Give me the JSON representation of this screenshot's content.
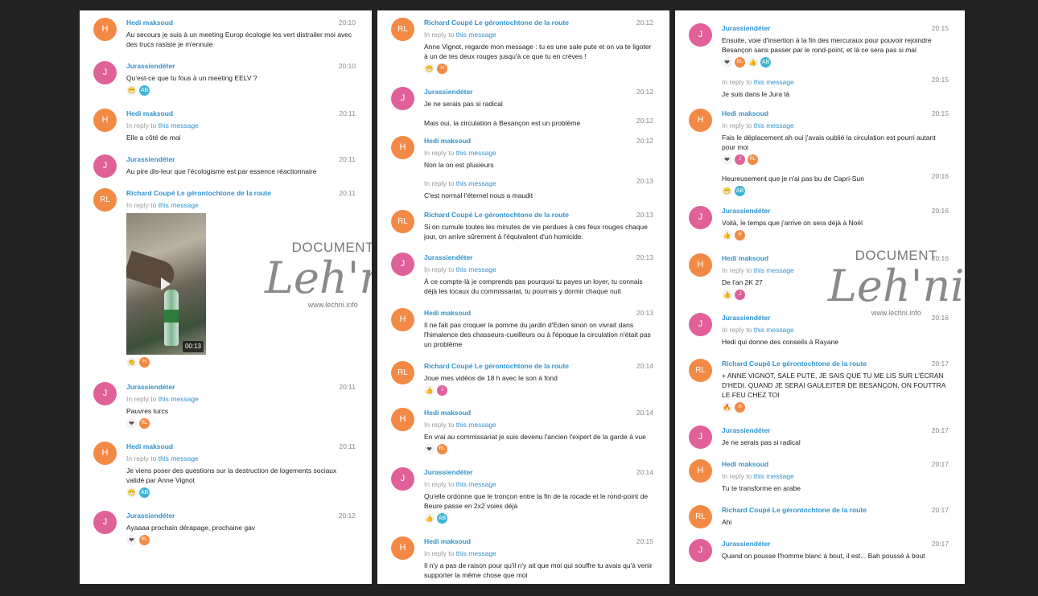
{
  "reply_prefix": "In reply to",
  "reply_link": "this message",
  "watermark": {
    "title": "DOCUMENT",
    "signature": "Lechni",
    "url": "www.lechni.info"
  },
  "video": {
    "duration": "00:13"
  },
  "panels": [
    {
      "messages": [
        {
          "avatar": "H",
          "name": "Hedi maksoud",
          "time": "20:10",
          "text": "Au secours je suis à un meeting Europ écologie les vert distrailer moi avec des trucs rasiste je m'ennuie"
        },
        {
          "avatar": "J",
          "name": "Jurassiendéter",
          "time": "20:10",
          "text": "Qu'est-ce que tu fous à un meeting EELV ?",
          "reactions": [
            "😁",
            "AB"
          ]
        },
        {
          "avatar": "H",
          "name": "Hedi maksoud",
          "time": "20:11",
          "reply": true,
          "text": "Elle a côté de moi"
        },
        {
          "avatar": "J",
          "name": "Jurassiendéter",
          "time": "20:11",
          "text": "Au pire dis-leur que l'écologisme est par essence réactionnaire"
        },
        {
          "avatar": "RL",
          "name": "Richard Coupé Le gérontochtone de la route",
          "time": "20:11",
          "reply": true,
          "video": true,
          "reactions": [
            "👏",
            "H"
          ]
        },
        {
          "avatar": "J",
          "name": "Jurassiendéter",
          "time": "20:11",
          "reply": true,
          "text": "Pauvres turcs",
          "reactions": [
            "❤",
            "RL"
          ]
        },
        {
          "avatar": "H",
          "name": "Hedi maksoud",
          "time": "20:11",
          "reply": true,
          "text": "Je viens poser des questions sur la destruction de logements sociaux validé par Anne Vignot",
          "reactions": [
            "😁",
            "AB"
          ]
        },
        {
          "avatar": "J",
          "name": "Jurassiendéter",
          "time": "20:12",
          "text": "Ayaaaa prochain dérapage, prochaine gav",
          "reactions": [
            "❤",
            "RL"
          ]
        }
      ]
    },
    {
      "messages": [
        {
          "avatar": "RL",
          "name": "Richard Coupé Le gérontochtone de la route",
          "time": "20:12",
          "reply": true,
          "text": "Anne Vignot, regarde mon message : tu es une sale pute et on va te ligoter à un de tes deux rouges jusqu'à ce que tu en crèves !",
          "reactions": [
            "😁",
            "H"
          ]
        },
        {
          "avatar": "J",
          "name": "Jurassiendéter",
          "time": "20:12",
          "text": "Je ne serais pas si radical"
        },
        {
          "cont": true,
          "time": "20:12",
          "text": "Mais oui, la circulation à Besançon est un problème"
        },
        {
          "avatar": "H",
          "name": "Hedi maksoud",
          "time": "20:12",
          "reply": true,
          "text": "Non la on est plusieurs"
        },
        {
          "cont": true,
          "time": "20:13",
          "reply": true,
          "text": "C'est normal l'éternel nous a maudit"
        },
        {
          "avatar": "RL",
          "name": "Richard Coupé Le gérontochtone de la route",
          "time": "20:13",
          "text": "Si on cumule toutes les minutes de vie perdues à ces feux rouges chaque jour, on arrive sûrement à l'équivalent d'un homicide."
        },
        {
          "avatar": "J",
          "name": "Jurassiendéter",
          "time": "20:13",
          "reply": true,
          "text": "À ce compte-là je comprends pas pourquoi tu payes un loyer, tu connais déjà les locaux du commissariat, tu pourrais y dormir chaque nuit"
        },
        {
          "avatar": "H",
          "name": "Hedi maksoud",
          "time": "20:13",
          "text": "Il ne fait pas croquer la pomme du jardin d'Eden sinon on vivrait dans l'himalence des chasseurs-cueilleurs ou à l'époque la circulation n'était pas un problème"
        },
        {
          "avatar": "RL",
          "name": "Richard Coupé Le gérontochtone de la route",
          "time": "20:14",
          "text": "Joue mes vidéos de 18 h avec le son à fond",
          "reactions": [
            "👍",
            "J"
          ]
        },
        {
          "avatar": "H",
          "name": "Hedi maksoud",
          "time": "20:14",
          "reply": true,
          "text": "En vrai au commissariat je suis devenu l'ancien l'expert de la garde à vue",
          "reactions": [
            "❤",
            "RL"
          ]
        },
        {
          "avatar": "J",
          "name": "Jurassiendéter",
          "time": "20:14",
          "reply": true,
          "text": "Qu'elle ordonne que le tronçon entre la fin de la rocade et le rond-point de Beure passe en 2x2 voies déjà",
          "reactions": [
            "👍",
            "AB"
          ]
        },
        {
          "avatar": "H",
          "name": "Hedi maksoud",
          "time": "20:15",
          "reply": true,
          "text": "Il n'y a pas de raison pour qu'il n'y ait que moi qui souffre tu avais qu'à venir supporter la même chose que moi"
        }
      ]
    },
    {
      "messages": [
        {
          "avatar": "J",
          "name": "Jurassiendéter",
          "time": "20:15",
          "text": "Ensuite, voie d'insertion à la fin des mercuraux pour pouvoir rejoindre Besançon sans passer par le rond-point, et là ce sera pas si mal",
          "reactions": [
            "❤",
            "RL",
            "👍",
            "AB"
          ]
        },
        {
          "cont": true,
          "time": "20:15",
          "reply": true,
          "text": "Je suis dans le Jura là"
        },
        {
          "avatar": "H",
          "name": "Hedi maksoud",
          "time": "20:15",
          "reply": true,
          "text": "Fais le déplacement ah oui j'avais oublié la circulation est pourri autant pour moi",
          "reactions": [
            "❤",
            "J",
            "RL"
          ]
        },
        {
          "cont": true,
          "time": "20:16",
          "text": "Heureusement que je n'ai pas bu de Capri-Sun",
          "reactions": [
            "😁",
            "AB"
          ]
        },
        {
          "avatar": "J",
          "name": "Jurassiendéter",
          "time": "20:16",
          "text": "Voilà, le temps que j'arrive on sera déjà à Noël",
          "reactions": [
            "👍",
            "H"
          ]
        },
        {
          "avatar": "H",
          "name": "Hedi maksoud",
          "time": "20:16",
          "reply": true,
          "text": "De l'an 2K 27",
          "reactions": [
            "👍",
            "J"
          ]
        },
        {
          "avatar": "J",
          "name": "Jurassiendéter",
          "time": "20:16",
          "reply": true,
          "text": "Hedi qui donne des conseils à Rayane"
        },
        {
          "avatar": "RL",
          "name": "Richard Coupé Le gérontochtone de la route",
          "time": "20:17",
          "text": "+ ANNE VIGNOT, SALE PUTE, JE SAIS QUE TU ME LIS SUR L'ÉCRAN D'HEDI. QUAND JE SERAI GAULEITER DE BESANÇON, ON FOUTTRA LE FEU CHEZ TOI",
          "reactions": [
            "🔥",
            "H"
          ]
        },
        {
          "avatar": "J",
          "name": "Jurassiendéter",
          "time": "20:17",
          "text": "Je ne serais pas si radical"
        },
        {
          "avatar": "H",
          "name": "Hedi maksoud",
          "time": "20:17",
          "reply": true,
          "text": "Tu te transforme en arabe"
        },
        {
          "avatar": "RL",
          "name": "Richard Coupé Le gérontochtone de la route",
          "time": "20:17",
          "text": "Ahi"
        },
        {
          "avatar": "J",
          "name": "Jurassiendéter",
          "time": "20:17",
          "text": "Quand on pousse l'homme blanc à bout, il est... Bah poussé à bout"
        }
      ]
    }
  ]
}
